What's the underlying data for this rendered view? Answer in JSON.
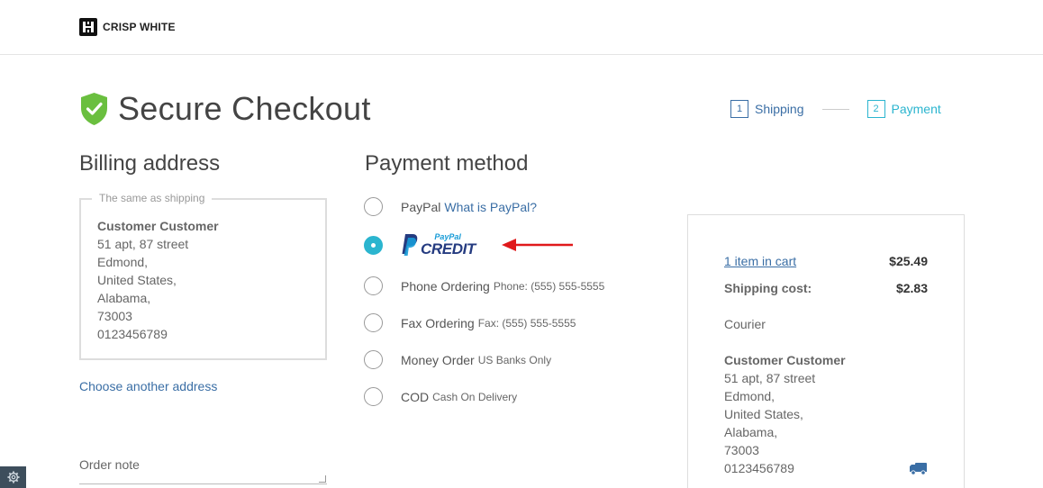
{
  "header": {
    "logo_text": "CRISP WHITE"
  },
  "page": {
    "title": "Secure Checkout"
  },
  "steps": [
    {
      "num": "1",
      "label": "Shipping"
    },
    {
      "num": "2",
      "label": "Payment"
    }
  ],
  "billing": {
    "heading": "Billing address",
    "legend": "The same as shipping",
    "name": "Customer Customer",
    "lines": [
      "51 apt, 87 street",
      "Edmond,",
      "United States,",
      "Alabama,",
      "73003",
      "0123456789"
    ],
    "choose_link": "Choose another address",
    "order_note_label": "Order note"
  },
  "payment": {
    "heading": "Payment method",
    "paypal": {
      "name": "PayPal",
      "link": "What is PayPal?"
    },
    "paypal_credit": {
      "small": "PayPal",
      "big": "CREDIT"
    },
    "phone": {
      "name": "Phone Ordering",
      "note": "Phone: (555) 555-5555"
    },
    "fax": {
      "name": "Fax Ordering",
      "note": "Fax: (555) 555-5555"
    },
    "money": {
      "name": "Money Order",
      "note": "US Banks Only"
    },
    "cod": {
      "name": "COD",
      "note": "Cash On Delivery"
    },
    "selected": "paypal_credit"
  },
  "summary": {
    "cart_link": "1 item in cart",
    "cart_total": "$25.49",
    "shipping_label": "Shipping cost:",
    "shipping_value": "$2.83",
    "method": "Courier",
    "name": "Customer Customer",
    "lines": [
      "51 apt, 87 street",
      "Edmond,",
      "United States,",
      "Alabama,",
      "73003",
      "0123456789"
    ]
  },
  "icons": {
    "shield": "shield-check-icon",
    "truck": "truck-icon",
    "settings": "gear-icon",
    "arrow": "arrow-left-icon"
  },
  "colors": {
    "accent": "#2bb5cf",
    "link": "#3a6ea5",
    "shield": "#6abf3f",
    "arrow": "#e0191b",
    "paypal_dark": "#253b80",
    "paypal_light": "#179bd7"
  }
}
